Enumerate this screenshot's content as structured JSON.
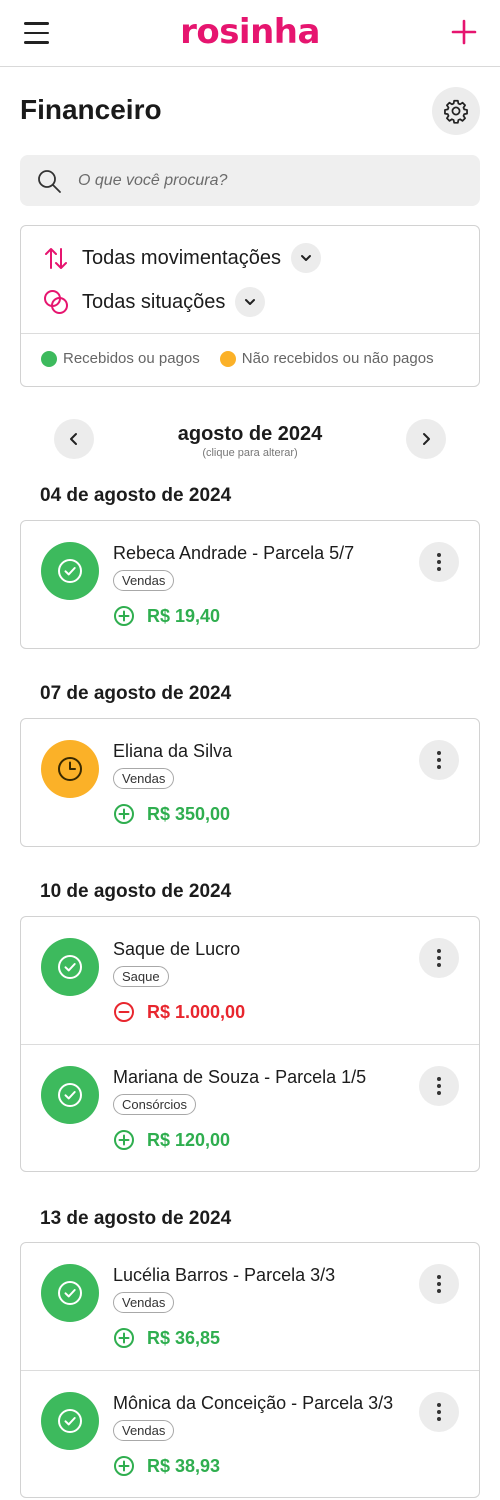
{
  "header": {
    "logo": "rosinha"
  },
  "page": {
    "title": "Financeiro"
  },
  "search": {
    "placeholder": "O que você procura?"
  },
  "filters": {
    "movements": "Todas movimentações",
    "situations": "Todas situações",
    "legend": {
      "received": "Recebidos ou pagos",
      "pending": "Não recebidos ou não pagos"
    }
  },
  "colors": {
    "brand": "#e6156f",
    "received": "#3dba5d",
    "pending": "#fbb128",
    "income": "#2fae4f",
    "expense": "#e8262e"
  },
  "month": {
    "label": "agosto de 2024",
    "hint": "(clique para alterar)"
  },
  "groups": [
    {
      "date": "04 de agosto de 2024",
      "entries": [
        {
          "name": "Rebeca Andrade - Parcela 5/7",
          "tag": "Vendas",
          "amount": "R$ 19,40",
          "type": "income",
          "status": "received"
        }
      ]
    },
    {
      "date": "07 de agosto de 2024",
      "entries": [
        {
          "name": "Eliana da Silva",
          "tag": "Vendas",
          "amount": "R$ 350,00",
          "type": "income",
          "status": "pending"
        }
      ]
    },
    {
      "date": "10 de agosto de 2024",
      "entries": [
        {
          "name": "Saque de Lucro",
          "tag": "Saque",
          "amount": "R$ 1.000,00",
          "type": "expense",
          "status": "received"
        },
        {
          "name": "Mariana de Souza - Parcela 1/5",
          "tag": "Consórcios",
          "amount": "R$ 120,00",
          "type": "income",
          "status": "received"
        }
      ]
    },
    {
      "date": "13 de agosto de 2024",
      "entries": [
        {
          "name": "Lucélia Barros - Parcela 3/3",
          "tag": "Vendas",
          "amount": "R$ 36,85",
          "type": "income",
          "status": "received"
        },
        {
          "name": "Mônica da Conceição - Parcela 3/3",
          "tag": "Vendas",
          "amount": "R$ 38,93",
          "type": "income",
          "status": "received"
        }
      ]
    }
  ]
}
